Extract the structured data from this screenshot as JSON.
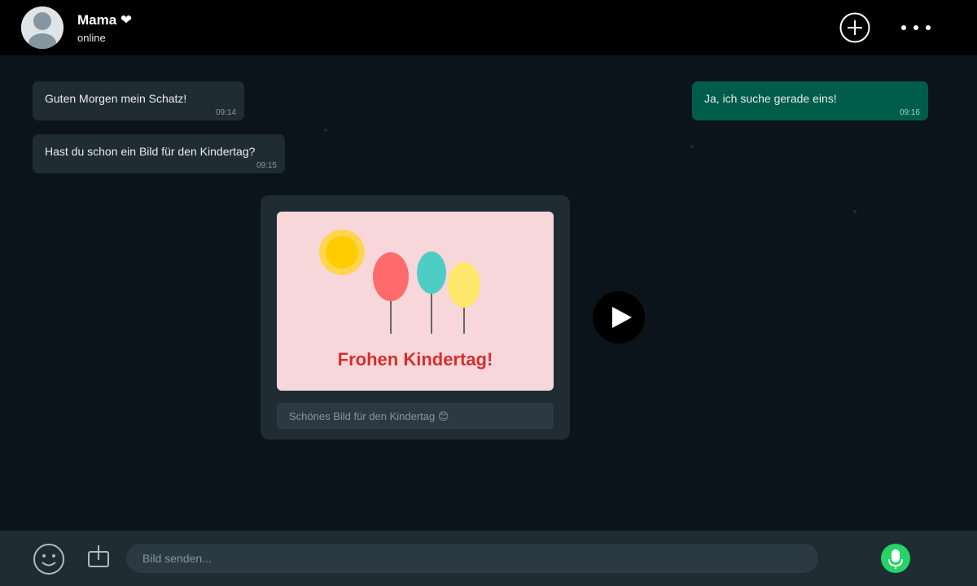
{
  "header": {
    "contact_name": "Mama ❤",
    "status": "online",
    "icons": {
      "avatar": "person-avatar-icon",
      "new": "plus-circle-icon",
      "menu": "more-dots-icon"
    }
  },
  "messages": [
    {
      "direction": "incoming",
      "text": "Guten Morgen mein Schatz!",
      "time": "09:14"
    },
    {
      "direction": "incoming",
      "text": "Hast du schon ein Bild für den Kindertag?",
      "time": "09:15"
    },
    {
      "direction": "outgoing",
      "text": "Ja, ich suche gerade eins!",
      "time": "09:16"
    }
  ],
  "media": {
    "image_title": "Frohen Kindertag!",
    "caption": "Schönes Bild für den Kindertag 😊",
    "play_icon": "play-icon"
  },
  "composer": {
    "placeholder": "Bild senden...",
    "icons": {
      "emoji": "smiley-icon",
      "attach": "attach-icon",
      "mic": "microphone-icon"
    }
  },
  "colors": {
    "background": "#0b141a",
    "header": "#000000",
    "incoming_bubble": "#202c33",
    "outgoing_bubble": "#005c4b",
    "accent_green": "#25d366",
    "image_title": "#d32f2f"
  }
}
